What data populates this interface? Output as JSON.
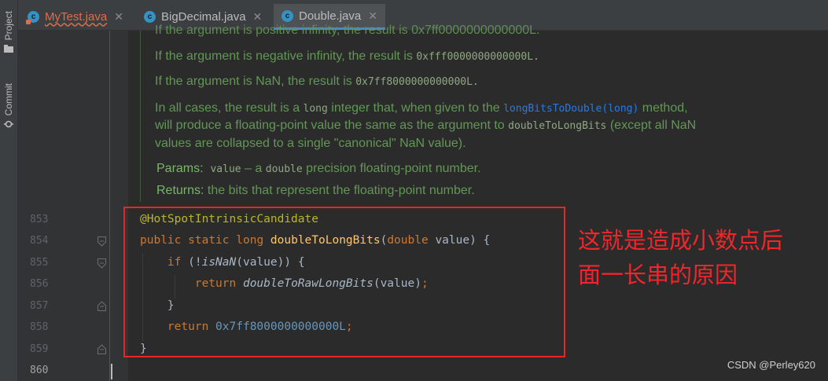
{
  "sidebar": {
    "project_label": "Project",
    "commit_label": "Commit"
  },
  "tabs": [
    {
      "label": "MyTest.java",
      "icon": "c",
      "state": "error"
    },
    {
      "label": "BigDecimal.java",
      "icon": "c",
      "state": "normal"
    },
    {
      "label": "Double.java",
      "icon": "c",
      "state": "active"
    }
  ],
  "doc": {
    "clipped_line": "If the argument is positive infinity, the result is 0x7ff0000000000000L.",
    "neg_inf_text": "If the argument is negative infinity, the result is ",
    "neg_inf_code": "0xfff0000000000000L.",
    "nan_text": "If the argument is NaN, the result is ",
    "nan_code": "0x7ff8000000000000L.",
    "all_cases_1": "In all cases, the result is a ",
    "all_cases_long": "long",
    "all_cases_2": " integer that, when given to the ",
    "all_cases_link": "longBitsToDouble(long)",
    "all_cases_3": " method,",
    "all_cases_4": "will produce a floating-point value the same as the argument to ",
    "all_cases_code": "doubleToLongBits",
    "all_cases_5": " (except all NaN",
    "all_cases_6": "values are collapsed to a single \"canonical\" NaN value).",
    "params_tag": "Params:",
    "params_code": "value",
    "params_text_1": " – a ",
    "params_code_2": "double",
    "params_text_2": " precision floating-point number.",
    "returns_tag": "Returns:",
    "returns_text": "the bits that represent the floating-point number."
  },
  "code": {
    "line_numbers": [
      "853",
      "854",
      "855",
      "856",
      "857",
      "858",
      "859",
      "860"
    ],
    "annotation": "@HotSpotIntrinsicCandidate",
    "kw_public": "public",
    "kw_static": "static",
    "kw_long": "long",
    "method_name": "doubleToLongBits",
    "open_paren": "(",
    "kw_double": "double",
    "param": " value) {",
    "kw_if": "if",
    "if_1": " (!",
    "isnan": "isNaN",
    "if_2": "(value)) {",
    "kw_return": "return",
    "raw_call": "doubleToRawLongBits",
    "raw_args": "(value)",
    "semicolon": ";",
    "close_brace_inner": "}",
    "hex_literal": "0x7ff8000000000000L",
    "close_brace_outer": "}"
  },
  "annotation_note": {
    "line1": "这就是造成小数点后",
    "line2": "面一长串的原因"
  },
  "watermark": "CSDN @Perley620",
  "colors": {
    "background": "#2b2b2b",
    "doc_text": "#629755",
    "keyword": "#cc7832",
    "annotation": "#bbb529",
    "method": "#ffc66d",
    "number": "#6897bb",
    "highlight_box": "#e8262a"
  }
}
